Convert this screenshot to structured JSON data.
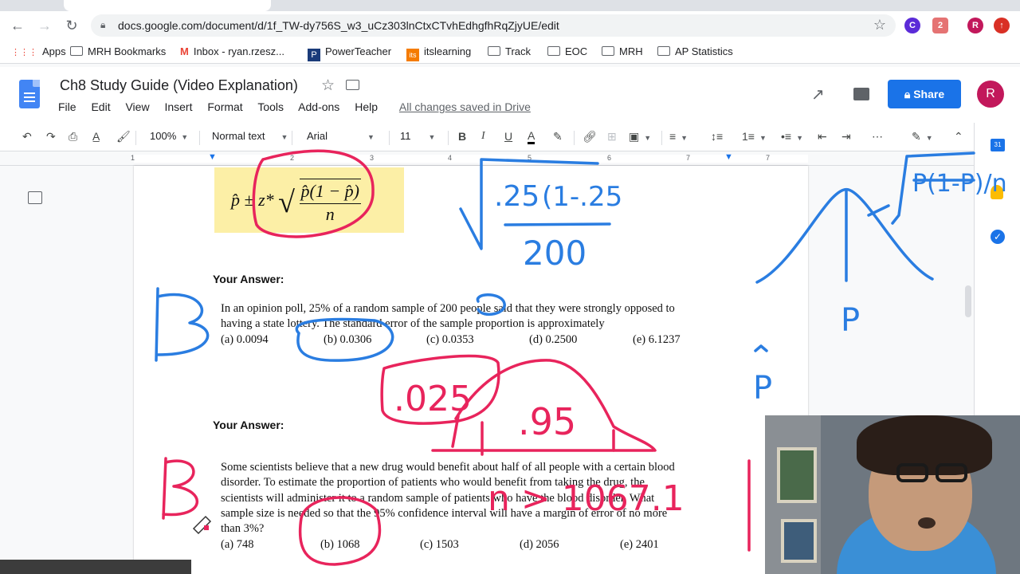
{
  "browser": {
    "url": "docs.google.com/document/d/1f_TW-dy756S_w3_uCz303lnCtxCTvhEdhgfhRqZjyUE/edit",
    "bookmarks": [
      "Apps",
      "MRH Bookmarks",
      "Inbox - ryan.rzesz...",
      "PowerTeacher",
      "itslearning",
      "Track",
      "EOC",
      "MRH",
      "AP Statistics"
    ],
    "ext_badge": "2",
    "profile_initial": "R"
  },
  "doc": {
    "title": "Ch8 Study Guide (Video Explanation)",
    "menu": [
      "File",
      "Edit",
      "View",
      "Insert",
      "Format",
      "Tools",
      "Add-ons",
      "Help"
    ],
    "saved_status": "All changes saved in Drive",
    "share_label": "Share",
    "avatar_initial": "R"
  },
  "toolbar": {
    "zoom": "100%",
    "style": "Normal text",
    "font": "Arial",
    "size": "11"
  },
  "ruler": [
    "1",
    "1",
    "2",
    "3",
    "4",
    "5",
    "6",
    "7"
  ],
  "side_panel": {
    "calendar_day": "31"
  },
  "content": {
    "formula_main": "p̂ ± z*",
    "formula_num": "p̂(1 − p̂)",
    "formula_den": "n",
    "answer_label_1": "Your Answer:",
    "q1_line1": "In an opinion poll, 25% of a random sample of 200 people said that they were strongly opposed to",
    "q1_line2": "having a state lottery.  The standard error of the sample proportion is approximately",
    "q1_choices": [
      "(a) 0.0094",
      "(b) 0.0306",
      "(c) 0.0353",
      "(d) 0.2500",
      "(e) 6.1237"
    ],
    "answer_label_2": "Your Answer:",
    "q2_line1": "Some scientists believe that a new drug would benefit about half of all people with a certain blood",
    "q2_line2": "disorder.  To estimate the proportion of patients who would benefit from taking the drug, the",
    "q2_line3": "scientists will administer it to a random sample of patients who have the blood disorder.  What",
    "q2_line4": "sample size is needed so that the 95% confidence interval will have a margin of error of no more",
    "q2_line5": "than 3%?",
    "q2_choices": [
      "(a) 748",
      "(b) 1068",
      "(c) 1503",
      "(d) 2056",
      "(e) 2401"
    ]
  },
  "annotations": {
    "ink_blue": "#2a7de1",
    "ink_pink": "#e8245c",
    "answer_1": "B",
    "answer_2": "B",
    "num_25": ".25",
    "num_1_25": "(1-.25",
    "num_200": "200",
    "tail": ".025",
    "center": ".95",
    "n_result": "n > 1067.1",
    "p_label": "P",
    "p_hat_label": "^P",
    "sqrt_inside": "P(1-P)/n"
  }
}
